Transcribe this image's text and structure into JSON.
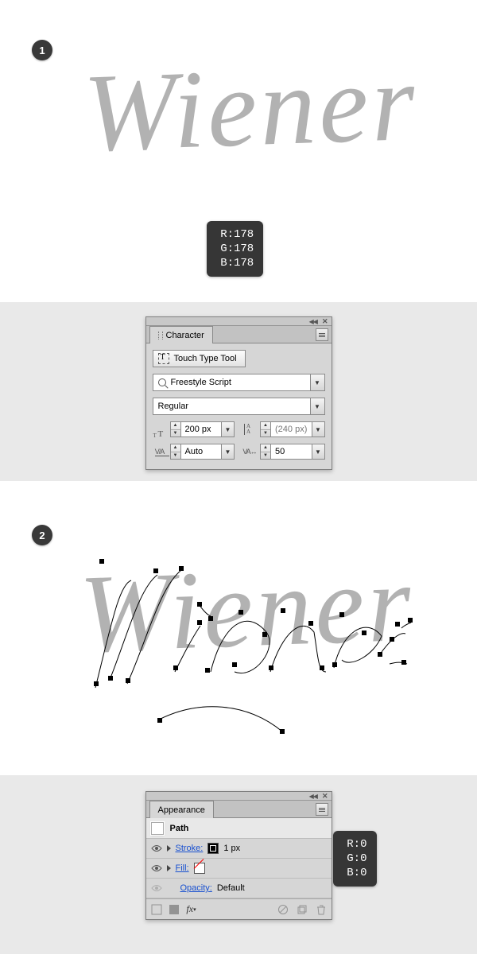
{
  "step1": {
    "badge": "1"
  },
  "step2": {
    "badge": "2"
  },
  "script": {
    "word": "Wiener"
  },
  "rgb1": {
    "r_label": "R:",
    "r": "178",
    "g_label": "G:",
    "g": "178",
    "b_label": "B:",
    "b": "178"
  },
  "rgb2": {
    "r_label": "R:",
    "r": "0",
    "g_label": "G:",
    "g": "0",
    "b_label": "B:",
    "b": "0"
  },
  "char": {
    "tab": "Character",
    "touch_type": "Touch Type Tool",
    "font_family": "Freestyle Script",
    "font_style": "Regular",
    "size": "200 px",
    "leading": "(240 px)",
    "kerning": "Auto",
    "tracking": "50"
  },
  "appearance": {
    "tab": "Appearance",
    "path": "Path",
    "stroke_label": "Stroke:",
    "stroke_value": "1 px",
    "fill_label": "Fill:",
    "opacity_label": "Opacity:",
    "opacity_value": "Default",
    "fx": "fx"
  }
}
